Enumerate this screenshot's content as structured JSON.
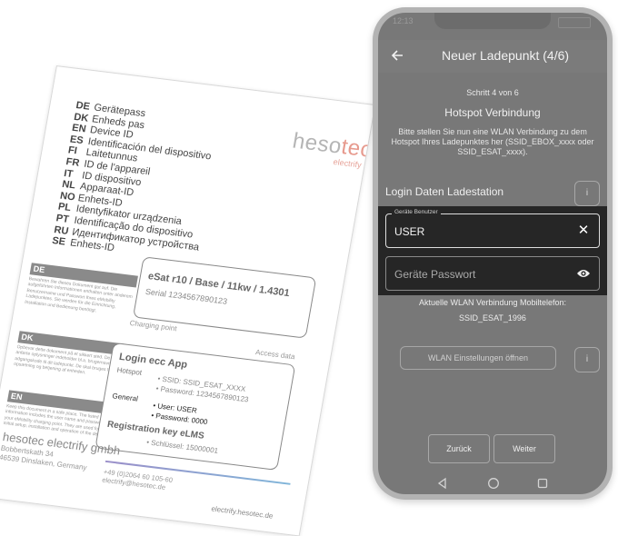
{
  "document": {
    "brand": "hesotec",
    "brand_sub": "electrify",
    "languages": [
      {
        "code": "DE",
        "label": "Gerätepass"
      },
      {
        "code": "DK",
        "label": "Enheds pas"
      },
      {
        "code": "EN",
        "label": "Device ID"
      },
      {
        "code": "ES",
        "label": "Identificación del dispositivo"
      },
      {
        "code": "FI",
        "label": "Laitetunnus"
      },
      {
        "code": "FR",
        "label": "ID de l'appareil"
      },
      {
        "code": "IT",
        "label": "ID dispositivo"
      },
      {
        "code": "NL",
        "label": "Apparaat-ID"
      },
      {
        "code": "NO",
        "label": "Enhets-ID"
      },
      {
        "code": "PL",
        "label": "Identyfikator urządzenia"
      },
      {
        "code": "PT",
        "label": "Identificação do dispositivo"
      },
      {
        "code": "RU",
        "label": "Идентификатор устройства"
      },
      {
        "code": "SE",
        "label": "Enhets-ID"
      }
    ],
    "sections": [
      {
        "title": "DE",
        "text": "Bewahren Sie dieses Dokument gut auf. Die aufgeführten Informationen enthalten unter anderem Benutzername und Passwort Ihres eMobility Ladepunktes. Sie werden für die Einrichtung, Installation und Bedienung benötigt."
      },
      {
        "title": "DK",
        "text": "Opbevar dette dokument på et sikkert sted. De anførte oplysninger indeholder bl.a. brugernavn og adgangskode til dit ladepunkt. De skal bruges til opsætning og betjening af enheden."
      },
      {
        "title": "EN",
        "text": "Keep this document in a safe place. The listed information includes the user name and password of your eMobility charging point. They are used for initial setup, installation and operation of the device."
      }
    ],
    "device_name": "eSat r10 / Base / 11kw / 1.4301",
    "serial": "Serial 1234567890123",
    "charging_point": "Charging point",
    "access_data": "Access data",
    "login_title": "Login ecc App",
    "hotspot_label": "Hotspot",
    "ssid_line": "• SSID: SSID_ESAT_XXXX",
    "password_line": "• Password: 1234567890123",
    "general_label": "General",
    "user_line": "• User: USER",
    "general_password_line": "• Password: 0000",
    "registration_title": "Registration key eLMS",
    "key_line": "• Schlüssel: 15000001",
    "company_name": "hesotec electrify gmbh",
    "company_street": "Bobbertskath 34",
    "company_city": "46539 Dinslaken, Germany",
    "company_phone": "+49 (0)2064 60 105-60",
    "company_email": "electrify@hesotec.de",
    "company_web": "electrify.hesotec.de"
  },
  "phone": {
    "status_time": "12:13",
    "header_title": "Neuer Ladepunkt (4/6)",
    "step_label": "Schritt 4 von 6",
    "hotspot_heading": "Hotspot Verbindung",
    "instruction": "Bitte stellen Sie nun eine WLAN Verbindung zu dem Hotspot Ihres Ladepunktes her (SSID_EBOX_xxxx oder SSID_ESAT_xxxx).",
    "login_section_title": "Login Daten Ladestation",
    "info_label": "i",
    "user_field_label": "Geräte Benutzer",
    "user_field_value": "USER",
    "password_placeholder": "Geräte Passwort",
    "current_wlan_label": "Aktuelle WLAN Verbindung Mobiltelefon:",
    "current_wlan_ssid": "SSID_ESAT_1996",
    "wlan_button_label": "WLAN Einstellungen öffnen",
    "back_button_label": "Zurück",
    "next_button_label": "Weiter",
    "icons": {
      "back": "arrow-left-icon",
      "clear": "close-icon",
      "visibility": "eye-icon",
      "nav_back": "triangle-left-icon",
      "nav_home": "circle-icon",
      "nav_recent": "square-icon"
    }
  }
}
